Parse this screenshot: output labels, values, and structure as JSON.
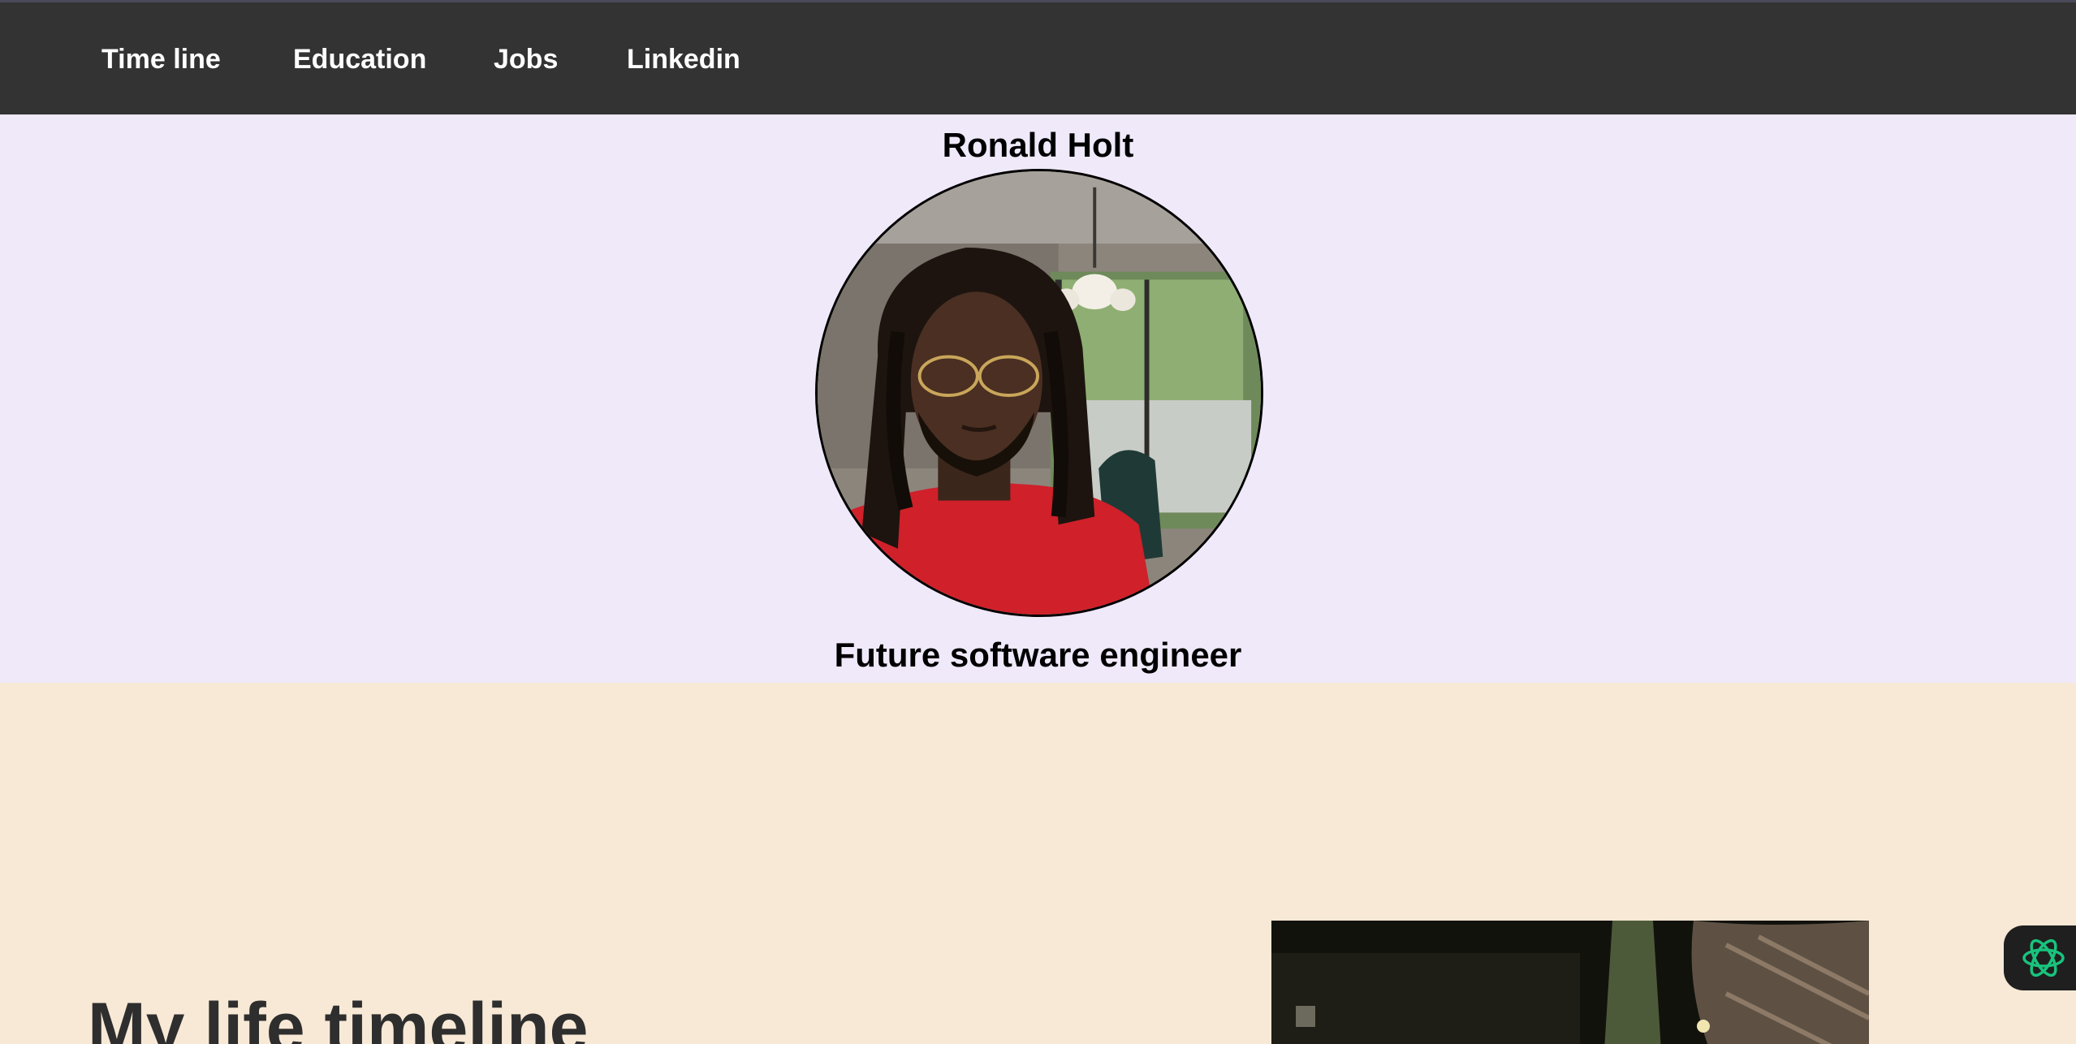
{
  "nav": {
    "items": [
      {
        "label": "Time line"
      },
      {
        "label": "Education"
      },
      {
        "label": "Jobs"
      },
      {
        "label": "Linkedin"
      }
    ],
    "background": "#333333",
    "text_color": "#ffffff"
  },
  "hero": {
    "name": "Ronald Holt",
    "tagline": "Future software engineer",
    "background": "#efe9fa"
  },
  "timeline": {
    "heading": "My life timeline",
    "background": "#f8e9d6"
  },
  "icons": {
    "assistant": "openai-knot-icon"
  },
  "colors": {
    "assistant_icon": "#19c37d"
  }
}
